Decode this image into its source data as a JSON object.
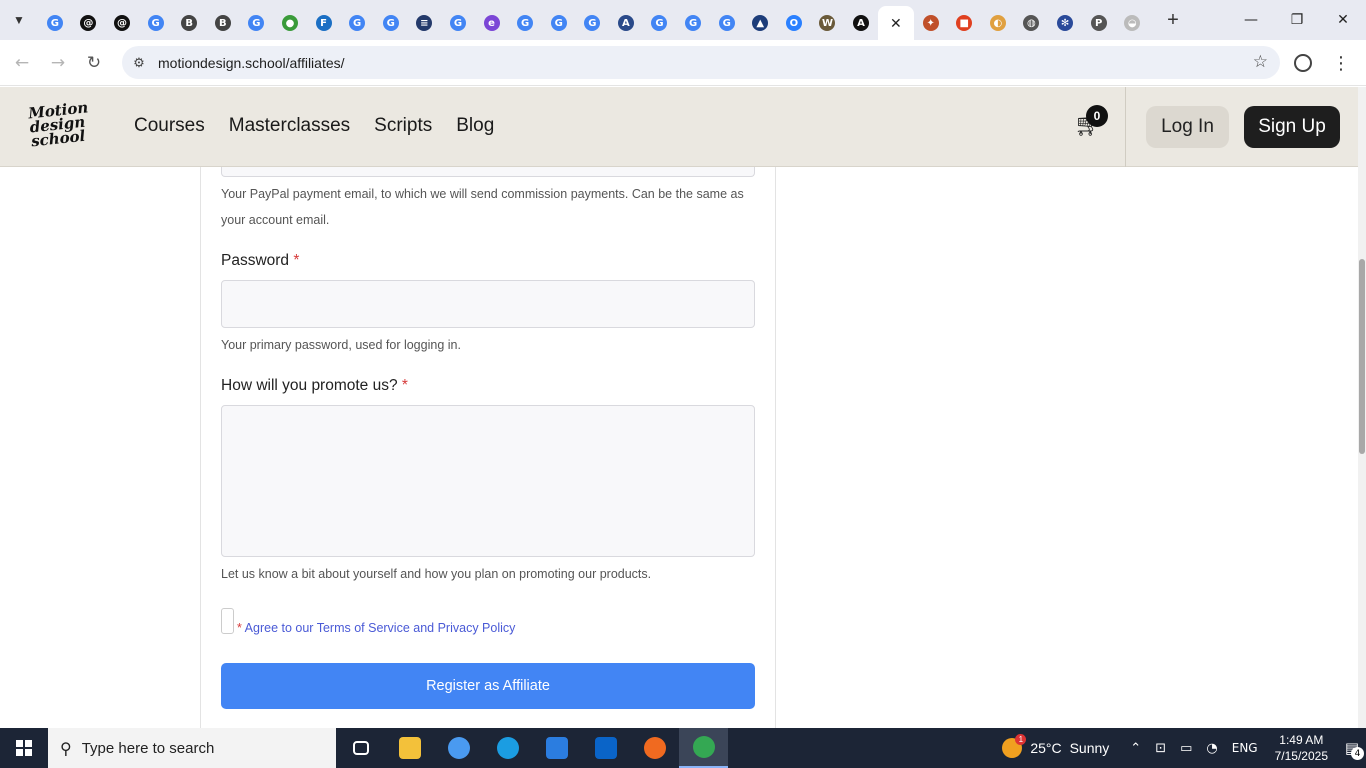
{
  "browser": {
    "tabs": [
      {
        "icon": "google-icon",
        "glyph": "G",
        "color": "#4285f4"
      },
      {
        "icon": "threads-icon",
        "glyph": "@",
        "color": "#111111"
      },
      {
        "icon": "threads-icon",
        "glyph": "@",
        "color": "#111111"
      },
      {
        "icon": "google-icon",
        "glyph": "G",
        "color": "#4285f4"
      },
      {
        "icon": "b-icon",
        "glyph": "B",
        "color": "#444444"
      },
      {
        "icon": "b-icon",
        "glyph": "B",
        "color": "#444444"
      },
      {
        "icon": "google-icon",
        "glyph": "G",
        "color": "#4285f4"
      },
      {
        "icon": "globe-green-icon",
        "glyph": "●",
        "color": "#3a9b3a"
      },
      {
        "icon": "xf-icon",
        "glyph": "F",
        "color": "#1b6fc4"
      },
      {
        "icon": "google-icon",
        "glyph": "G",
        "color": "#4285f4"
      },
      {
        "icon": "google-icon",
        "glyph": "G",
        "color": "#4285f4"
      },
      {
        "icon": "stack-icon",
        "glyph": "≡",
        "color": "#243a6b"
      },
      {
        "icon": "google-icon",
        "glyph": "G",
        "color": "#4285f4"
      },
      {
        "icon": "e-icon",
        "glyph": "e",
        "color": "#7b46d6"
      },
      {
        "icon": "google-icon",
        "glyph": "G",
        "color": "#4285f4"
      },
      {
        "icon": "google-icon",
        "glyph": "G",
        "color": "#4285f4"
      },
      {
        "icon": "google-icon",
        "glyph": "G",
        "color": "#4285f4"
      },
      {
        "icon": "wave-icon",
        "glyph": "A",
        "color": "#2a4a8a"
      },
      {
        "icon": "google-icon",
        "glyph": "G",
        "color": "#4285f4"
      },
      {
        "icon": "google-icon",
        "glyph": "G",
        "color": "#4285f4"
      },
      {
        "icon": "google-icon",
        "glyph": "G",
        "color": "#4285f4"
      },
      {
        "icon": "arrow-icon",
        "glyph": "▲",
        "color": "#1d3d7a"
      },
      {
        "icon": "ring-icon",
        "glyph": "O",
        "color": "#2a80ff"
      },
      {
        "icon": "w-icon",
        "glyph": "W",
        "color": "#6a5a3a"
      },
      {
        "icon": "ai-icon",
        "glyph": "A",
        "color": "#111111"
      }
    ],
    "tabs_after": [
      {
        "icon": "game-icon",
        "glyph": "✦",
        "color": "#c0502a"
      },
      {
        "icon": "red-app-icon",
        "glyph": "■",
        "color": "#e04020"
      },
      {
        "icon": "palette-icon",
        "glyph": "◐",
        "color": "#e0a040"
      },
      {
        "icon": "globe-icon",
        "glyph": "◍",
        "color": "#555555"
      },
      {
        "icon": "gear-icon",
        "glyph": "✻",
        "color": "#2a4a9a"
      },
      {
        "icon": "ip-icon",
        "glyph": "P",
        "color": "#555555"
      },
      {
        "icon": "cloud-icon",
        "glyph": "◒",
        "color": "#bbbbbb"
      }
    ],
    "url": "motiondesign.school/affiliates/"
  },
  "site": {
    "logo_text": "Motion design school",
    "nav": [
      "Courses",
      "Masterclasses",
      "Scripts",
      "Blog"
    ],
    "cart_count": "0",
    "login_label": "Log In",
    "signup_label": "Sign Up"
  },
  "form": {
    "paypal_help": "Your PayPal payment email, to which we will send commission payments. Can be the same as your account email.",
    "password_label": "Password",
    "required_mark": "*",
    "password_value": "",
    "password_help": "Your primary password, used for logging in.",
    "promote_label": "How will you promote us?",
    "promote_value": "",
    "promote_help": "Let us know a bit about yourself and how you plan on promoting our products.",
    "agree_text": "Agree to our Terms of Service and Privacy Policy",
    "submit_label": "Register as Affiliate"
  },
  "taskbar": {
    "search_placeholder": "Type here to search",
    "apps": [
      {
        "name": "task-view-icon",
        "color": "#ffffff"
      },
      {
        "name": "file-explorer-icon",
        "color": "#f3c13a"
      },
      {
        "name": "copilot-icon",
        "color": "#4a9af0"
      },
      {
        "name": "edge-icon",
        "color": "#1b9de2"
      },
      {
        "name": "store-icon",
        "color": "#2b7de0"
      },
      {
        "name": "outlook-icon",
        "color": "#0a64c8"
      },
      {
        "name": "firefox-icon",
        "color": "#f06a20"
      },
      {
        "name": "chrome-icon",
        "color": "#34a853"
      }
    ],
    "weather_temp": "25°C",
    "weather_text": "Sunny",
    "weather_badge": "1",
    "language": "ENG",
    "time": "1:49 AM",
    "date": "7/15/2025",
    "notification_count": "4"
  }
}
